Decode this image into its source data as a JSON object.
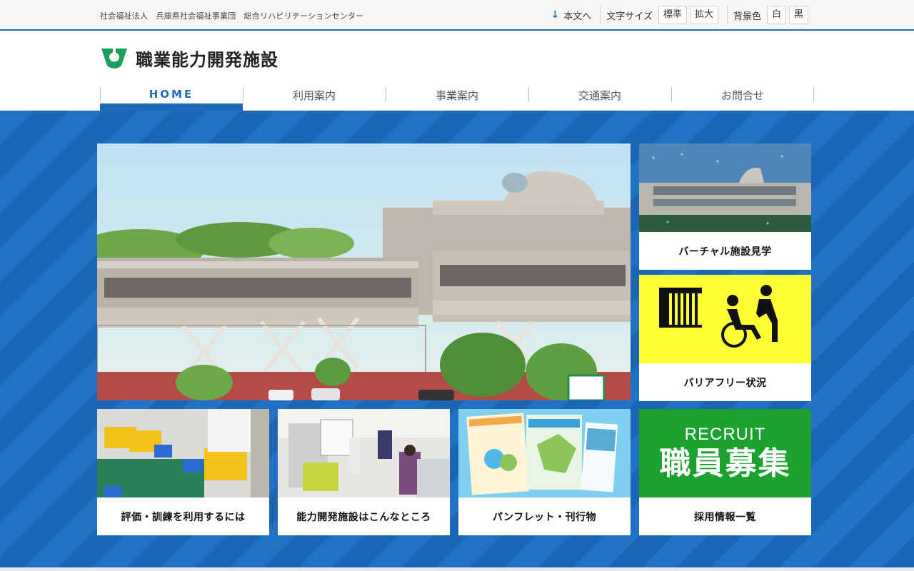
{
  "topbar": {
    "org": "社会福祉法人　兵庫県社会福祉事業団　総合リハビリテーションセンター",
    "skip_label": "本文へ",
    "font_size_label": "文字サイズ",
    "font_size_options": [
      "標準",
      "拡大"
    ],
    "bg_color_label": "背景色",
    "bg_color_options": [
      "白",
      "黒"
    ]
  },
  "header": {
    "title": "職業能力開発施設"
  },
  "nav": {
    "items": [
      "HOME",
      "利用案内",
      "事業案内",
      "交通案内",
      "お問合せ"
    ]
  },
  "cards": {
    "virtual_tour": "バーチャル施設見学",
    "barrier_free": "バリアフリー状況",
    "training": "評価・訓練を利用するには",
    "about": "能力開発施設はこんなところ",
    "pamphlet": "パンフレット・刊行物",
    "recruit": "採用情報一覧"
  },
  "recruit_banner": {
    "en": "RECRUIT",
    "jp": "職員募集"
  },
  "colors": {
    "brand_blue": "#1e6fb8",
    "stripe_light": "#1f72c6",
    "stripe_dark": "#1a66b5",
    "barrier_yellow": "#ffff33",
    "recruit_green": "#1aa12e",
    "logo_green": "#1aa05a"
  }
}
